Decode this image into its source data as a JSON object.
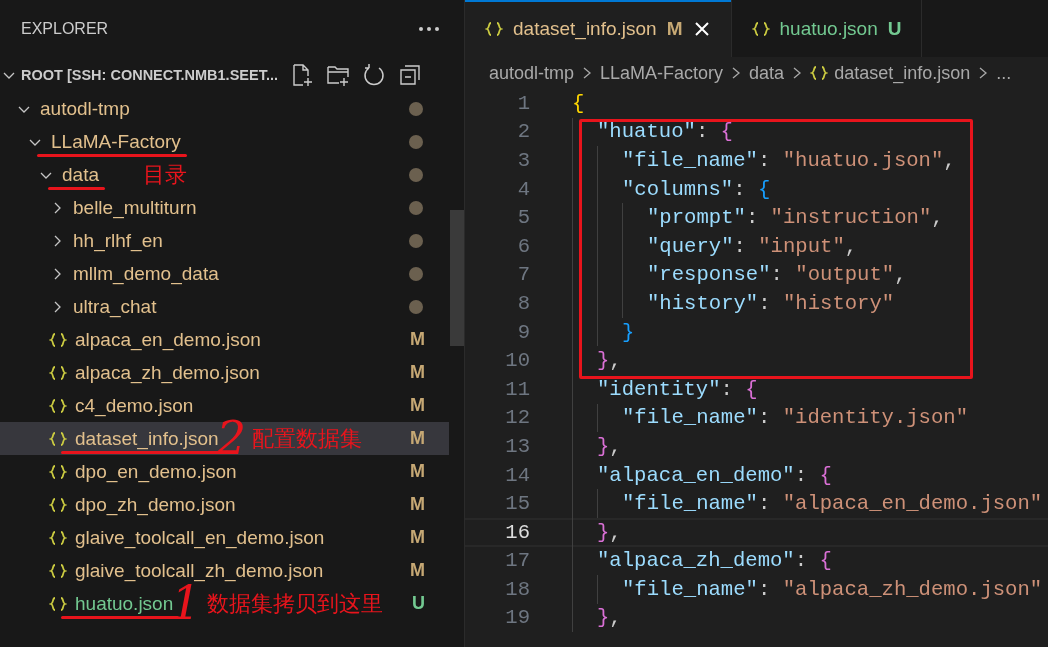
{
  "sidebar": {
    "title": "EXPLORER",
    "section": "ROOT [SSH: CONNECT.NMB1.SEET...",
    "tree": [
      {
        "kind": "folder",
        "name": "autodl-tmp",
        "expanded": true,
        "modified": true,
        "selected": false,
        "underlined": false,
        "children": [
          {
            "kind": "folder",
            "name": "LLaMA-Factory",
            "expanded": true,
            "modified": true,
            "selected": false,
            "underlined": true,
            "children": [
              {
                "kind": "folder",
                "name": "data",
                "expanded": true,
                "modified": true,
                "selected": false,
                "underlined": true,
                "note": "目录",
                "children": [
                  {
                    "kind": "folder",
                    "name": "belle_multiturn",
                    "expanded": false,
                    "modified": true,
                    "selected": false,
                    "underlined": false
                  },
                  {
                    "kind": "folder",
                    "name": "hh_rlhf_en",
                    "expanded": false,
                    "modified": true,
                    "selected": false,
                    "underlined": false
                  },
                  {
                    "kind": "folder",
                    "name": "mllm_demo_data",
                    "expanded": false,
                    "modified": true,
                    "selected": false,
                    "underlined": false
                  },
                  {
                    "kind": "folder",
                    "name": "ultra_chat",
                    "expanded": false,
                    "modified": true,
                    "selected": false,
                    "underlined": false
                  },
                  {
                    "kind": "file",
                    "name": "alpaca_en_demo.json",
                    "badge": "M",
                    "untracked": false,
                    "selected": false,
                    "underlined": false
                  },
                  {
                    "kind": "file",
                    "name": "alpaca_zh_demo.json",
                    "badge": "M",
                    "untracked": false,
                    "selected": false,
                    "underlined": false
                  },
                  {
                    "kind": "file",
                    "name": "c4_demo.json",
                    "badge": "M",
                    "untracked": false,
                    "selected": false,
                    "underlined": false
                  },
                  {
                    "kind": "file",
                    "name": "dataset_info.json",
                    "badge": "M",
                    "untracked": false,
                    "selected": true,
                    "underlined": true,
                    "mark": "2",
                    "note": "配置数据集"
                  },
                  {
                    "kind": "file",
                    "name": "dpo_en_demo.json",
                    "badge": "M",
                    "untracked": false,
                    "selected": false,
                    "underlined": false
                  },
                  {
                    "kind": "file",
                    "name": "dpo_zh_demo.json",
                    "badge": "M",
                    "untracked": false,
                    "selected": false,
                    "underlined": false
                  },
                  {
                    "kind": "file",
                    "name": "glaive_toolcall_en_demo.json",
                    "badge": "M",
                    "untracked": false,
                    "selected": false,
                    "underlined": false
                  },
                  {
                    "kind": "file",
                    "name": "glaive_toolcall_zh_demo.json",
                    "badge": "M",
                    "untracked": false,
                    "selected": false,
                    "underlined": false
                  },
                  {
                    "kind": "file",
                    "name": "huatuo.json",
                    "badge": "U",
                    "untracked": true,
                    "selected": false,
                    "underlined": true,
                    "mark": "1",
                    "note": "数据集拷贝到这里"
                  }
                ]
              }
            ]
          }
        ]
      }
    ]
  },
  "editor": {
    "tabs": [
      {
        "label": "dataset_info.json",
        "badge": "M",
        "untracked": false,
        "selected": true
      },
      {
        "label": "huatuo.json",
        "badge": "U",
        "untracked": true,
        "selected": false
      }
    ],
    "breadcrumb": [
      {
        "kind": "folder",
        "label": "autodl-tmp"
      },
      {
        "kind": "folder",
        "label": "LLaMA-Factory"
      },
      {
        "kind": "folder",
        "label": "data"
      },
      {
        "kind": "file",
        "label": "dataset_info.json"
      },
      {
        "kind": "more",
        "label": "..."
      }
    ],
    "lines": [
      {
        "kind": "line",
        "number": "1",
        "current": false,
        "tokens": [
          {
            "kind": "bracket",
            "text": "{"
          }
        ]
      },
      {
        "kind": "boxed_group",
        "lines": [
          {
            "kind": "line",
            "number": "2",
            "current": false,
            "tokens": [
              {
                "kind": "key",
                "text": "\"huatuo\""
              },
              {
                "kind": "punct",
                "text": ": "
              },
              {
                "kind": "bracket",
                "text": "{"
              }
            ]
          },
          {
            "kind": "line",
            "number": "3",
            "current": false,
            "tokens": [
              {
                "kind": "key",
                "text": "\"file_name\""
              },
              {
                "kind": "punct",
                "text": ": "
              },
              {
                "kind": "string",
                "text": "\"huatuo.json\""
              },
              {
                "kind": "punct",
                "text": ","
              }
            ]
          },
          {
            "kind": "line",
            "number": "4",
            "current": false,
            "tokens": [
              {
                "kind": "key",
                "text": "\"columns\""
              },
              {
                "kind": "punct",
                "text": ": "
              },
              {
                "kind": "bracket",
                "text": "{"
              }
            ]
          },
          {
            "kind": "line",
            "number": "5",
            "current": false,
            "tokens": [
              {
                "kind": "key",
                "text": "\"prompt\""
              },
              {
                "kind": "punct",
                "text": ": "
              },
              {
                "kind": "string",
                "text": "\"instruction\""
              },
              {
                "kind": "punct",
                "text": ","
              }
            ]
          },
          {
            "kind": "line",
            "number": "6",
            "current": false,
            "tokens": [
              {
                "kind": "key",
                "text": "\"query\""
              },
              {
                "kind": "punct",
                "text": ": "
              },
              {
                "kind": "string",
                "text": "\"input\""
              },
              {
                "kind": "punct",
                "text": ","
              }
            ]
          },
          {
            "kind": "line",
            "number": "7",
            "current": false,
            "tokens": [
              {
                "kind": "key",
                "text": "\"response\""
              },
              {
                "kind": "punct",
                "text": ": "
              },
              {
                "kind": "string",
                "text": "\"output\""
              },
              {
                "kind": "punct",
                "text": ","
              }
            ]
          },
          {
            "kind": "line",
            "number": "8",
            "current": false,
            "tokens": [
              {
                "kind": "key",
                "text": "\"history\""
              },
              {
                "kind": "punct",
                "text": ": "
              },
              {
                "kind": "string",
                "text": "\"history\""
              }
            ]
          },
          {
            "kind": "line",
            "number": "9",
            "current": false,
            "tokens": [
              {
                "kind": "bracket",
                "text": "}"
              }
            ]
          },
          {
            "kind": "line",
            "number": "10",
            "current": false,
            "tokens": [
              {
                "kind": "bracket",
                "text": "}"
              },
              {
                "kind": "punct",
                "text": ","
              }
            ]
          }
        ]
      },
      {
        "kind": "line",
        "number": "11",
        "current": false,
        "tokens": [
          {
            "kind": "key",
            "text": "\"identity\""
          },
          {
            "kind": "punct",
            "text": ": "
          },
          {
            "kind": "bracket",
            "text": "{"
          }
        ]
      },
      {
        "kind": "line",
        "number": "12",
        "current": false,
        "tokens": [
          {
            "kind": "key",
            "text": "\"file_name\""
          },
          {
            "kind": "punct",
            "text": ": "
          },
          {
            "kind": "string",
            "text": "\"identity.json\""
          }
        ]
      },
      {
        "kind": "line",
        "number": "13",
        "current": false,
        "tokens": [
          {
            "kind": "bracket",
            "text": "}"
          },
          {
            "kind": "punct",
            "text": ","
          }
        ]
      },
      {
        "kind": "line",
        "number": "14",
        "current": false,
        "tokens": [
          {
            "kind": "key",
            "text": "\"alpaca_en_demo\""
          },
          {
            "kind": "punct",
            "text": ": "
          },
          {
            "kind": "bracket",
            "text": "{"
          }
        ]
      },
      {
        "kind": "line",
        "number": "15",
        "current": false,
        "tokens": [
          {
            "kind": "key",
            "text": "\"file_name\""
          },
          {
            "kind": "punct",
            "text": ": "
          },
          {
            "kind": "string",
            "text": "\"alpaca_en_demo.json\""
          }
        ]
      },
      {
        "kind": "line",
        "number": "16",
        "current": true,
        "tokens": [
          {
            "kind": "bracket",
            "text": "}"
          },
          {
            "kind": "punct",
            "text": ","
          }
        ]
      },
      {
        "kind": "line",
        "number": "17",
        "current": false,
        "tokens": [
          {
            "kind": "key",
            "text": "\"alpaca_zh_demo\""
          },
          {
            "kind": "punct",
            "text": ": "
          },
          {
            "kind": "bracket",
            "text": "{"
          }
        ]
      },
      {
        "kind": "line",
        "number": "18",
        "current": false,
        "tokens": [
          {
            "kind": "key",
            "text": "\"file_name\""
          },
          {
            "kind": "punct",
            "text": ": "
          },
          {
            "kind": "string",
            "text": "\"alpaca_zh_demo.json\""
          }
        ]
      },
      {
        "kind": "line",
        "number": "19",
        "current": false,
        "tokens": [
          {
            "kind": "bracket",
            "text": "}"
          },
          {
            "kind": "punct",
            "text": ","
          }
        ]
      }
    ]
  }
}
